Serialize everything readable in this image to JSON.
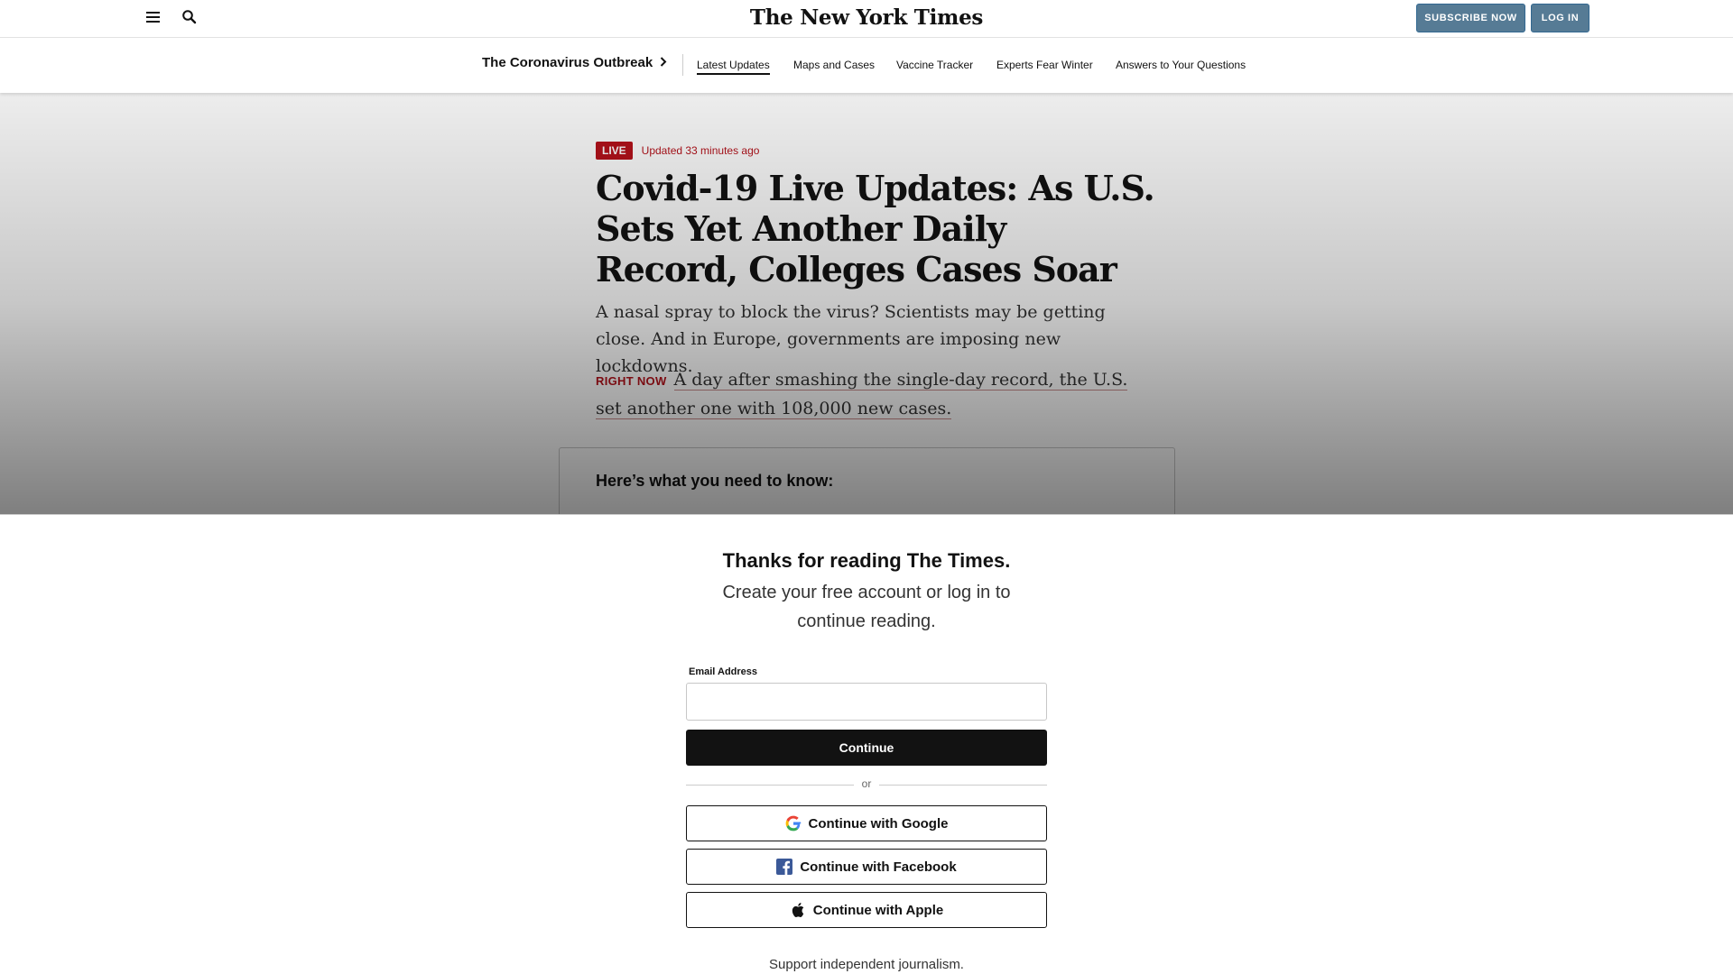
{
  "header": {
    "logo": "The New York Times",
    "subscribe_label": "SUBSCRIBE NOW",
    "login_label": "LOG IN"
  },
  "subnav": {
    "section_title": "The Coronavirus Outbreak",
    "links": [
      "Latest Updates",
      "Maps and Cases",
      "Vaccine Tracker",
      "Experts Fear Winter",
      "Answers to Your Questions"
    ],
    "active_link": "Latest Updates"
  },
  "article": {
    "live_label": "LIVE",
    "updated": "Updated 33 minutes ago",
    "headline": "Covid-19 Live Updates: As U.S. Sets Yet Another Daily Record, Colleges Cases Soar",
    "summary": "A nasal spray to block the virus? Scientists may be getting close. And in Europe, governments are imposing new lockdowns.",
    "right_now_tag": "RIGHT NOW",
    "right_now_text": "A day after smashing the single-day record, the U.S. set another one with 108,000 new cases.",
    "box_title": "Here’s what you need to know:"
  },
  "paywall": {
    "title": "Thanks for reading The Times.",
    "subtitle": "Create your free account or log in to continue reading.",
    "email_label": "Email Address",
    "email_value": "",
    "continue_label": "Continue",
    "or_label": "or",
    "google_label": "Continue with Google",
    "facebook_label": "Continue with Facebook",
    "apple_label": "Continue with Apple",
    "support_text": "Support independent journalism."
  },
  "colors": {
    "nyt_blue_button": "#567b95",
    "live_red": "#b5121b",
    "continue_black": "#121212",
    "facebook_blue": "#3b5998"
  },
  "icons": [
    "menu-icon",
    "search-icon",
    "chevron-right-icon",
    "google-icon",
    "facebook-icon",
    "apple-icon"
  ]
}
